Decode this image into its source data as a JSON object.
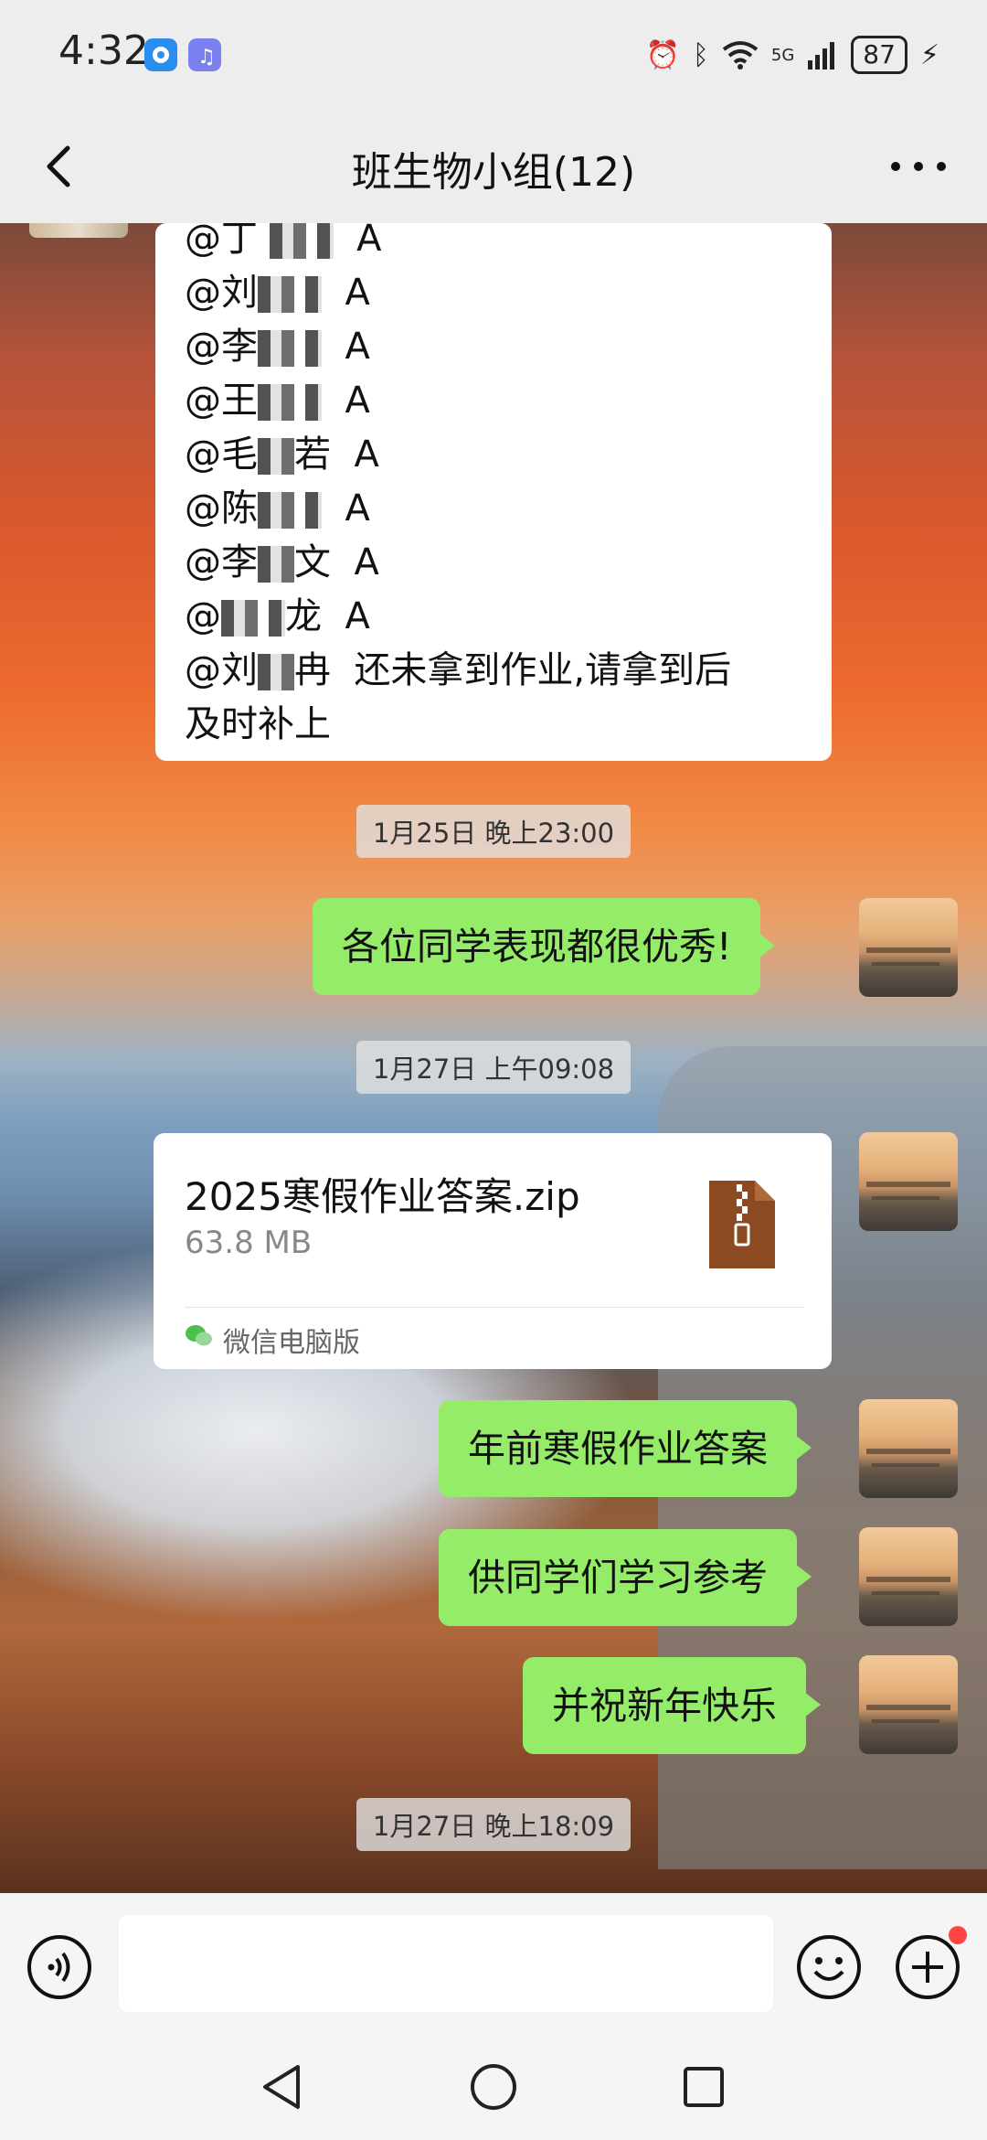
{
  "status_bar": {
    "time": "4:32",
    "network": "5G",
    "battery": "87"
  },
  "header": {
    "title": "班生物小组(12)"
  },
  "chat": {
    "mentions": [
      {
        "prefix": "@丁",
        "suffix": "A"
      },
      {
        "prefix": "@刘",
        "suffix": "A"
      },
      {
        "prefix": "@李",
        "suffix": "A"
      },
      {
        "prefix": "@王",
        "suffix": "A"
      },
      {
        "prefix": "@毛",
        "mid": "若",
        "suffix": "A"
      },
      {
        "prefix": "@陈",
        "suffix": "A"
      },
      {
        "prefix": "@李",
        "mid": "文",
        "suffix": "A"
      },
      {
        "prefix": "@",
        "mid": "龙",
        "suffix": "A"
      }
    ],
    "mention_last_prefix": "@刘",
    "mention_last_mid": "冉",
    "mention_last_text": "还未拿到作业,请拿到后",
    "mention_last_text2": "及时补上",
    "timestamps": [
      "1月25日 晚上23:00",
      "1月27日 上午09:08",
      "1月27日 晚上18:09"
    ],
    "messages": {
      "msg1": "各位同学表现都很优秀!",
      "msg2": "年前寒假作业答案",
      "msg3": "供同学们学习参考",
      "msg4": "并祝新年快乐"
    },
    "file": {
      "name": "2025寒假作业答案.zip",
      "size": "63.8 MB",
      "source": "微信电脑版"
    }
  },
  "colors": {
    "bubble_green": "#95ec69",
    "bubble_white": "#ffffff",
    "background": "#ededed"
  },
  "icons": [
    "back-arrow-icon",
    "more-icon",
    "voice-icon",
    "emoji-icon",
    "plus-icon",
    "zip-file-icon",
    "wechat-icon",
    "nav-back-icon",
    "nav-home-icon",
    "nav-recent-icon"
  ]
}
